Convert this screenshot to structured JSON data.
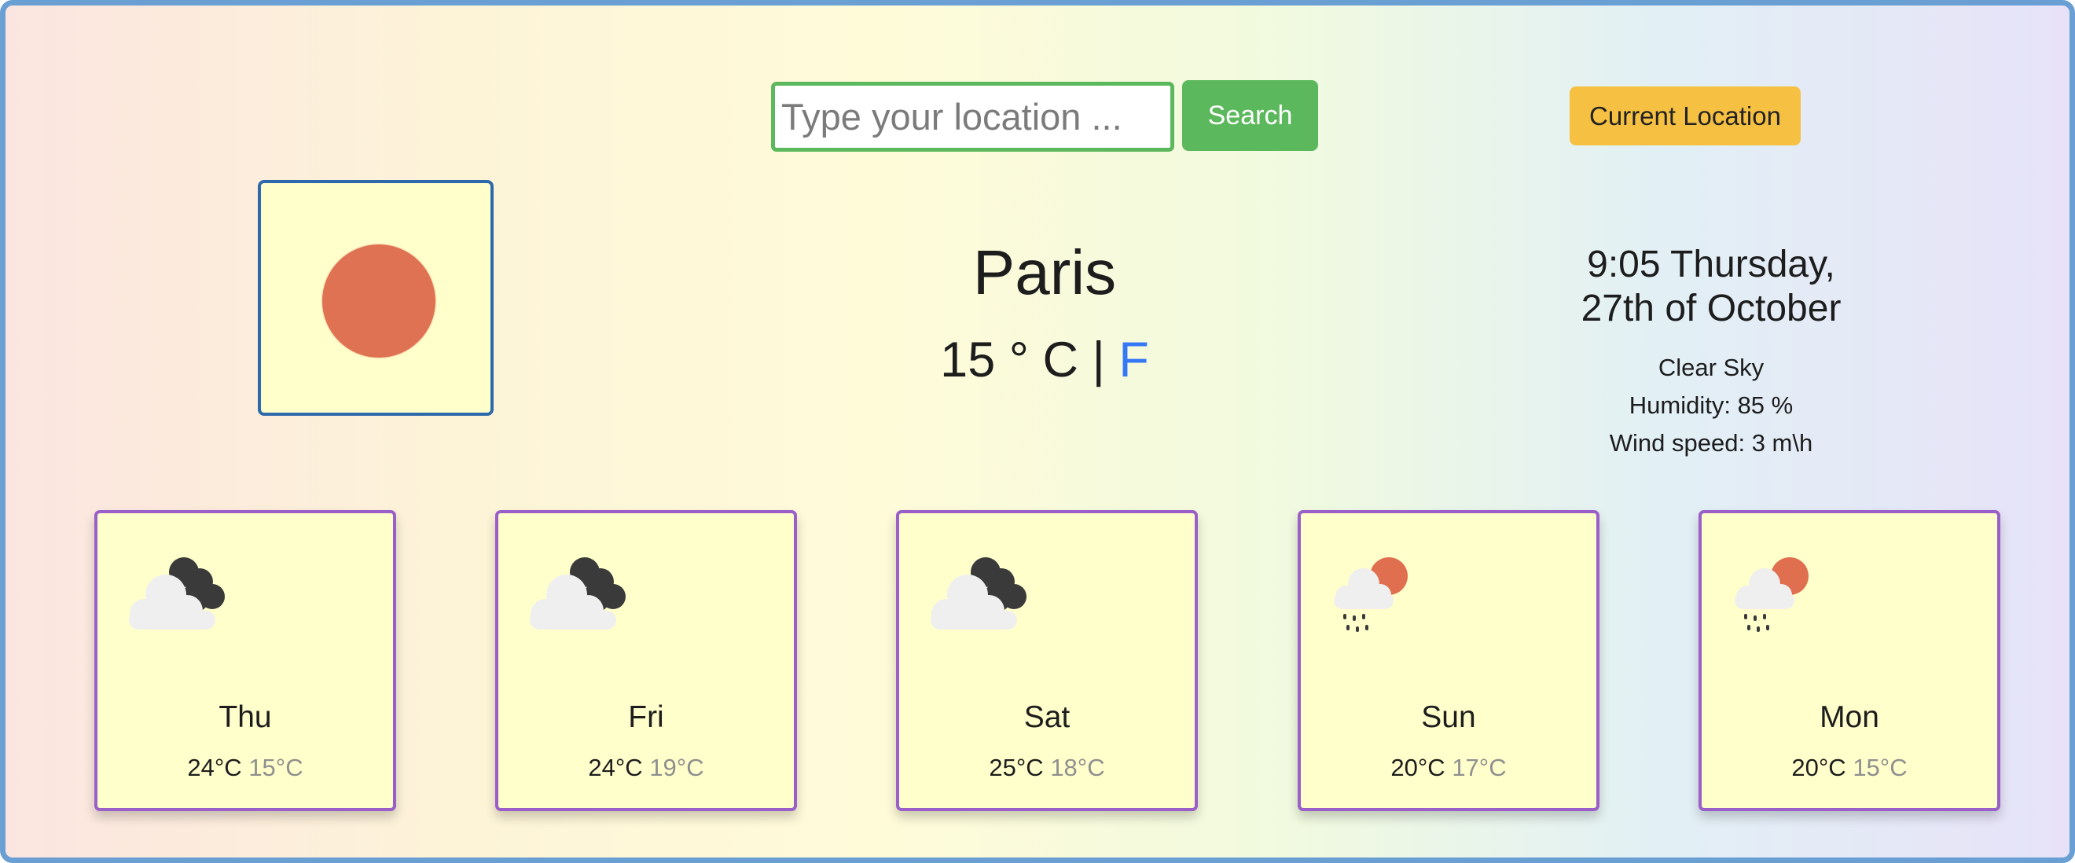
{
  "search": {
    "placeholder": "Type your location ...",
    "value": ""
  },
  "buttons": {
    "search_label": "Search",
    "current_location_label": "Current Location"
  },
  "current": {
    "icon": "sun-icon",
    "city": "Paris",
    "temp_value": "15",
    "unit_celsius": "° C",
    "separator": "|",
    "unit_fahrenheit": "F",
    "datetime_line1": "9:05 Thursday,",
    "datetime_line2": "27th of October",
    "description": "Clear Sky",
    "humidity": "Humidity: 85 %",
    "wind": "Wind speed: 3 m\\h"
  },
  "forecast": [
    {
      "day": "Thu",
      "max": "24°C",
      "min": "15°C",
      "icon": "cloudy-icon"
    },
    {
      "day": "Fri",
      "max": "24°C",
      "min": "19°C",
      "icon": "cloudy-icon"
    },
    {
      "day": "Sat",
      "max": "25°C",
      "min": "18°C",
      "icon": "cloudy-icon"
    },
    {
      "day": "Sun",
      "max": "20°C",
      "min": "17°C",
      "icon": "sun-rain-icon"
    },
    {
      "day": "Mon",
      "max": "20°C",
      "min": "15°C",
      "icon": "sun-rain-icon"
    }
  ],
  "colors": {
    "search_green": "#5cb85c",
    "location_yellow": "#f6c142",
    "fahrenheit_link": "#3478f6",
    "sun": "#df7252",
    "card_border": "#9a5fc8",
    "card_bg": "#ffffcc"
  }
}
